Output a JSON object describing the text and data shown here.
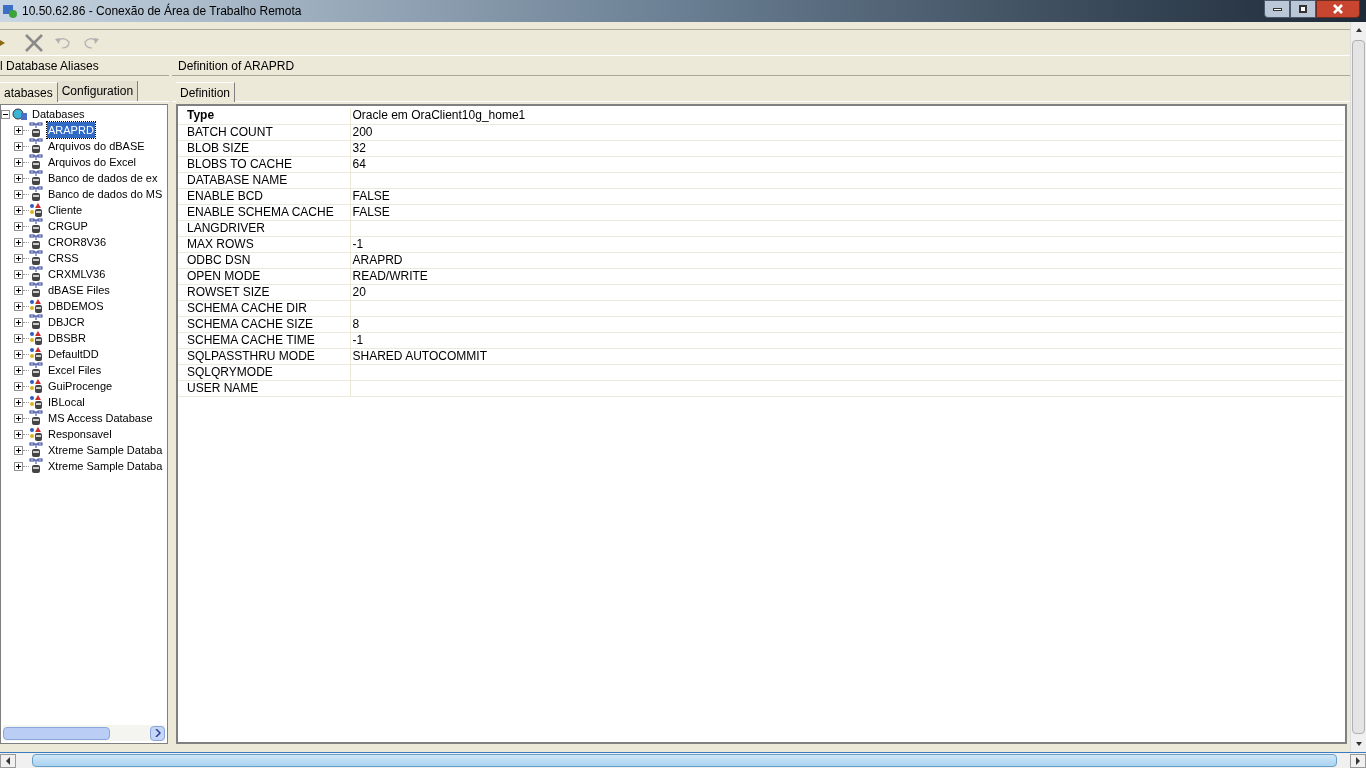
{
  "window": {
    "title": "10.50.62.86 - Conexão de Área de Trabalho Remota"
  },
  "left_panel": {
    "header": "l Database Aliases",
    "tabs": [
      {
        "label": "atabases",
        "selected": true
      },
      {
        "label": "Configuration",
        "selected": false
      }
    ],
    "tree": {
      "label": "Databases",
      "expanded": true,
      "children": [
        {
          "label": "ARAPRD",
          "kind": "odbc",
          "selected": true,
          "expanded": false
        },
        {
          "label": "Arquivos do dBASE",
          "kind": "odbc",
          "selected": false,
          "expanded": false
        },
        {
          "label": "Arquivos do Excel",
          "kind": "odbc",
          "selected": false,
          "expanded": false
        },
        {
          "label": "Banco de dados de ex",
          "kind": "odbc",
          "selected": false,
          "expanded": false
        },
        {
          "label": "Banco de dados do MS",
          "kind": "odbc",
          "selected": false,
          "expanded": false
        },
        {
          "label": "Cliente",
          "kind": "native",
          "selected": false,
          "expanded": false
        },
        {
          "label": "CRGUP",
          "kind": "odbc",
          "selected": false,
          "expanded": false
        },
        {
          "label": "CROR8V36",
          "kind": "odbc",
          "selected": false,
          "expanded": false
        },
        {
          "label": "CRSS",
          "kind": "odbc",
          "selected": false,
          "expanded": false
        },
        {
          "label": "CRXMLV36",
          "kind": "odbc",
          "selected": false,
          "expanded": false
        },
        {
          "label": "dBASE Files",
          "kind": "odbc",
          "selected": false,
          "expanded": false
        },
        {
          "label": "DBDEMOS",
          "kind": "native",
          "selected": false,
          "expanded": false
        },
        {
          "label": "DBJCR",
          "kind": "odbc",
          "selected": false,
          "expanded": false
        },
        {
          "label": "DBSBR",
          "kind": "native",
          "selected": false,
          "expanded": false
        },
        {
          "label": "DefaultDD",
          "kind": "native",
          "selected": false,
          "expanded": false
        },
        {
          "label": "Excel Files",
          "kind": "odbc",
          "selected": false,
          "expanded": false
        },
        {
          "label": "GuiProcenge",
          "kind": "native",
          "selected": false,
          "expanded": false
        },
        {
          "label": "IBLocal",
          "kind": "native",
          "selected": false,
          "expanded": false
        },
        {
          "label": "MS Access Database",
          "kind": "odbc",
          "selected": false,
          "expanded": false
        },
        {
          "label": "Responsavel",
          "kind": "native",
          "selected": false,
          "expanded": false
        },
        {
          "label": "Xtreme Sample Databa",
          "kind": "odbc",
          "selected": false,
          "expanded": false
        },
        {
          "label": "Xtreme Sample Databa",
          "kind": "odbc",
          "selected": false,
          "expanded": false
        }
      ]
    }
  },
  "right_panel": {
    "header": "Definition of ARAPRD",
    "tabs": [
      {
        "label": "Definition",
        "selected": true
      }
    ],
    "properties": [
      {
        "name": "Type",
        "value": "Oracle em OraClient10g_home1",
        "bold": true
      },
      {
        "name": "BATCH COUNT",
        "value": "200",
        "bold": false
      },
      {
        "name": "BLOB SIZE",
        "value": "32",
        "bold": false
      },
      {
        "name": "BLOBS TO CACHE",
        "value": "64",
        "bold": false
      },
      {
        "name": "DATABASE NAME",
        "bold": false
      },
      {
        "name": "ENABLE BCD",
        "value": "FALSE",
        "bold": false
      },
      {
        "name": "ENABLE SCHEMA CACHE",
        "value": "FALSE",
        "bold": false
      },
      {
        "name": "LANGDRIVER",
        "bold": false
      },
      {
        "name": "MAX ROWS",
        "value": "-1",
        "bold": false
      },
      {
        "name": "ODBC DSN",
        "value": "ARAPRD",
        "bold": false
      },
      {
        "name": "OPEN MODE",
        "value": "READ/WRITE",
        "bold": false
      },
      {
        "name": "ROWSET SIZE",
        "value": "20",
        "bold": false
      },
      {
        "name": "SCHEMA CACHE DIR",
        "bold": false
      },
      {
        "name": "SCHEMA CACHE SIZE",
        "value": "8",
        "bold": false
      },
      {
        "name": "SCHEMA CACHE TIME",
        "value": "-1",
        "bold": false
      },
      {
        "name": "SQLPASSTHRU MODE",
        "value": "SHARED AUTOCOMMIT",
        "bold": false
      },
      {
        "name": "SQLQRYMODE",
        "bold": false
      },
      {
        "name": "USER NAME",
        "bold": false
      }
    ]
  },
  "toolbar": {
    "undo_disabled": true,
    "redo_disabled": true
  }
}
